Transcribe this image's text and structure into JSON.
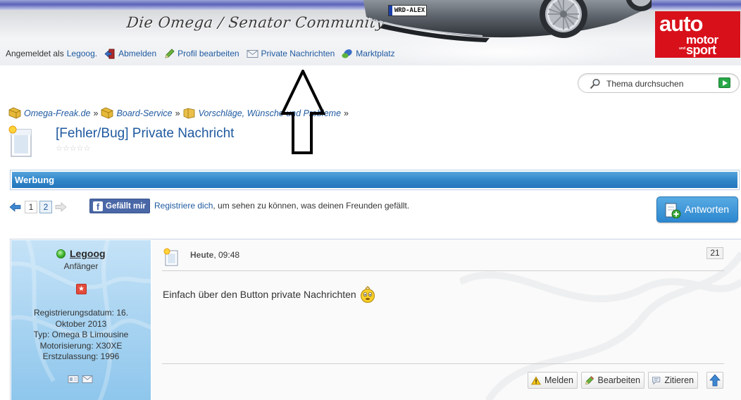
{
  "header": {
    "site_title": "Die Omega / Senator Community",
    "plate": "WRD-ALEX",
    "brand_logo": {
      "line1": "auto",
      "line2": "motor",
      "small": "und",
      "line3": "sport",
      "color": "#d8101a"
    }
  },
  "userbar": {
    "logged_in_prefix": "Angemeldet als",
    "username": "Legoog.",
    "items": [
      {
        "label": "Abmelden",
        "icon": "logout-icon"
      },
      {
        "label": "Profil bearbeiten",
        "icon": "pencil-icon"
      },
      {
        "label": "Private Nachrichten",
        "icon": "envelope-icon"
      },
      {
        "label": "Marktplatz",
        "icon": "marketplace-icon"
      }
    ]
  },
  "search": {
    "label": "Thema durchsuchen"
  },
  "breadcrumb": [
    {
      "label": "Omega-Freak.de"
    },
    {
      "label": "Board-Service"
    },
    {
      "label": "Vorschläge, Wünsche und Probleme"
    }
  ],
  "thread": {
    "title": "[Fehler/Bug] Private Nachricht",
    "rating": "☆☆☆☆☆"
  },
  "werbung": {
    "label": "Werbung",
    "color": "#2f85c9"
  },
  "pager": {
    "pages": [
      "1",
      "2"
    ],
    "current": "2"
  },
  "facebook": {
    "like_label": "Gefällt mir",
    "register_link": "Registriere dich",
    "register_rest": ", um sehen zu können, was deinen Freunden gefällt."
  },
  "reply_button": {
    "label": "Antworten"
  },
  "post": {
    "author": {
      "name": "Legoog",
      "online": true,
      "rank": "Anfänger",
      "info": [
        "Registrierungsdatum: 16.",
        "Oktober 2013",
        "Typ: Omega B Limousine",
        "Motorisierung: X30XE",
        "Erstzulassung: 1996"
      ]
    },
    "date_bold": "Heute",
    "date_rest": ", 09:48",
    "number": "21",
    "text": "Einfach über den Button private Nachrichten",
    "buttons": {
      "report": "Melden",
      "edit": "Bearbeiten",
      "quote": "Zitieren"
    }
  },
  "annotation": {
    "type": "arrow-up",
    "color": "#000000"
  }
}
